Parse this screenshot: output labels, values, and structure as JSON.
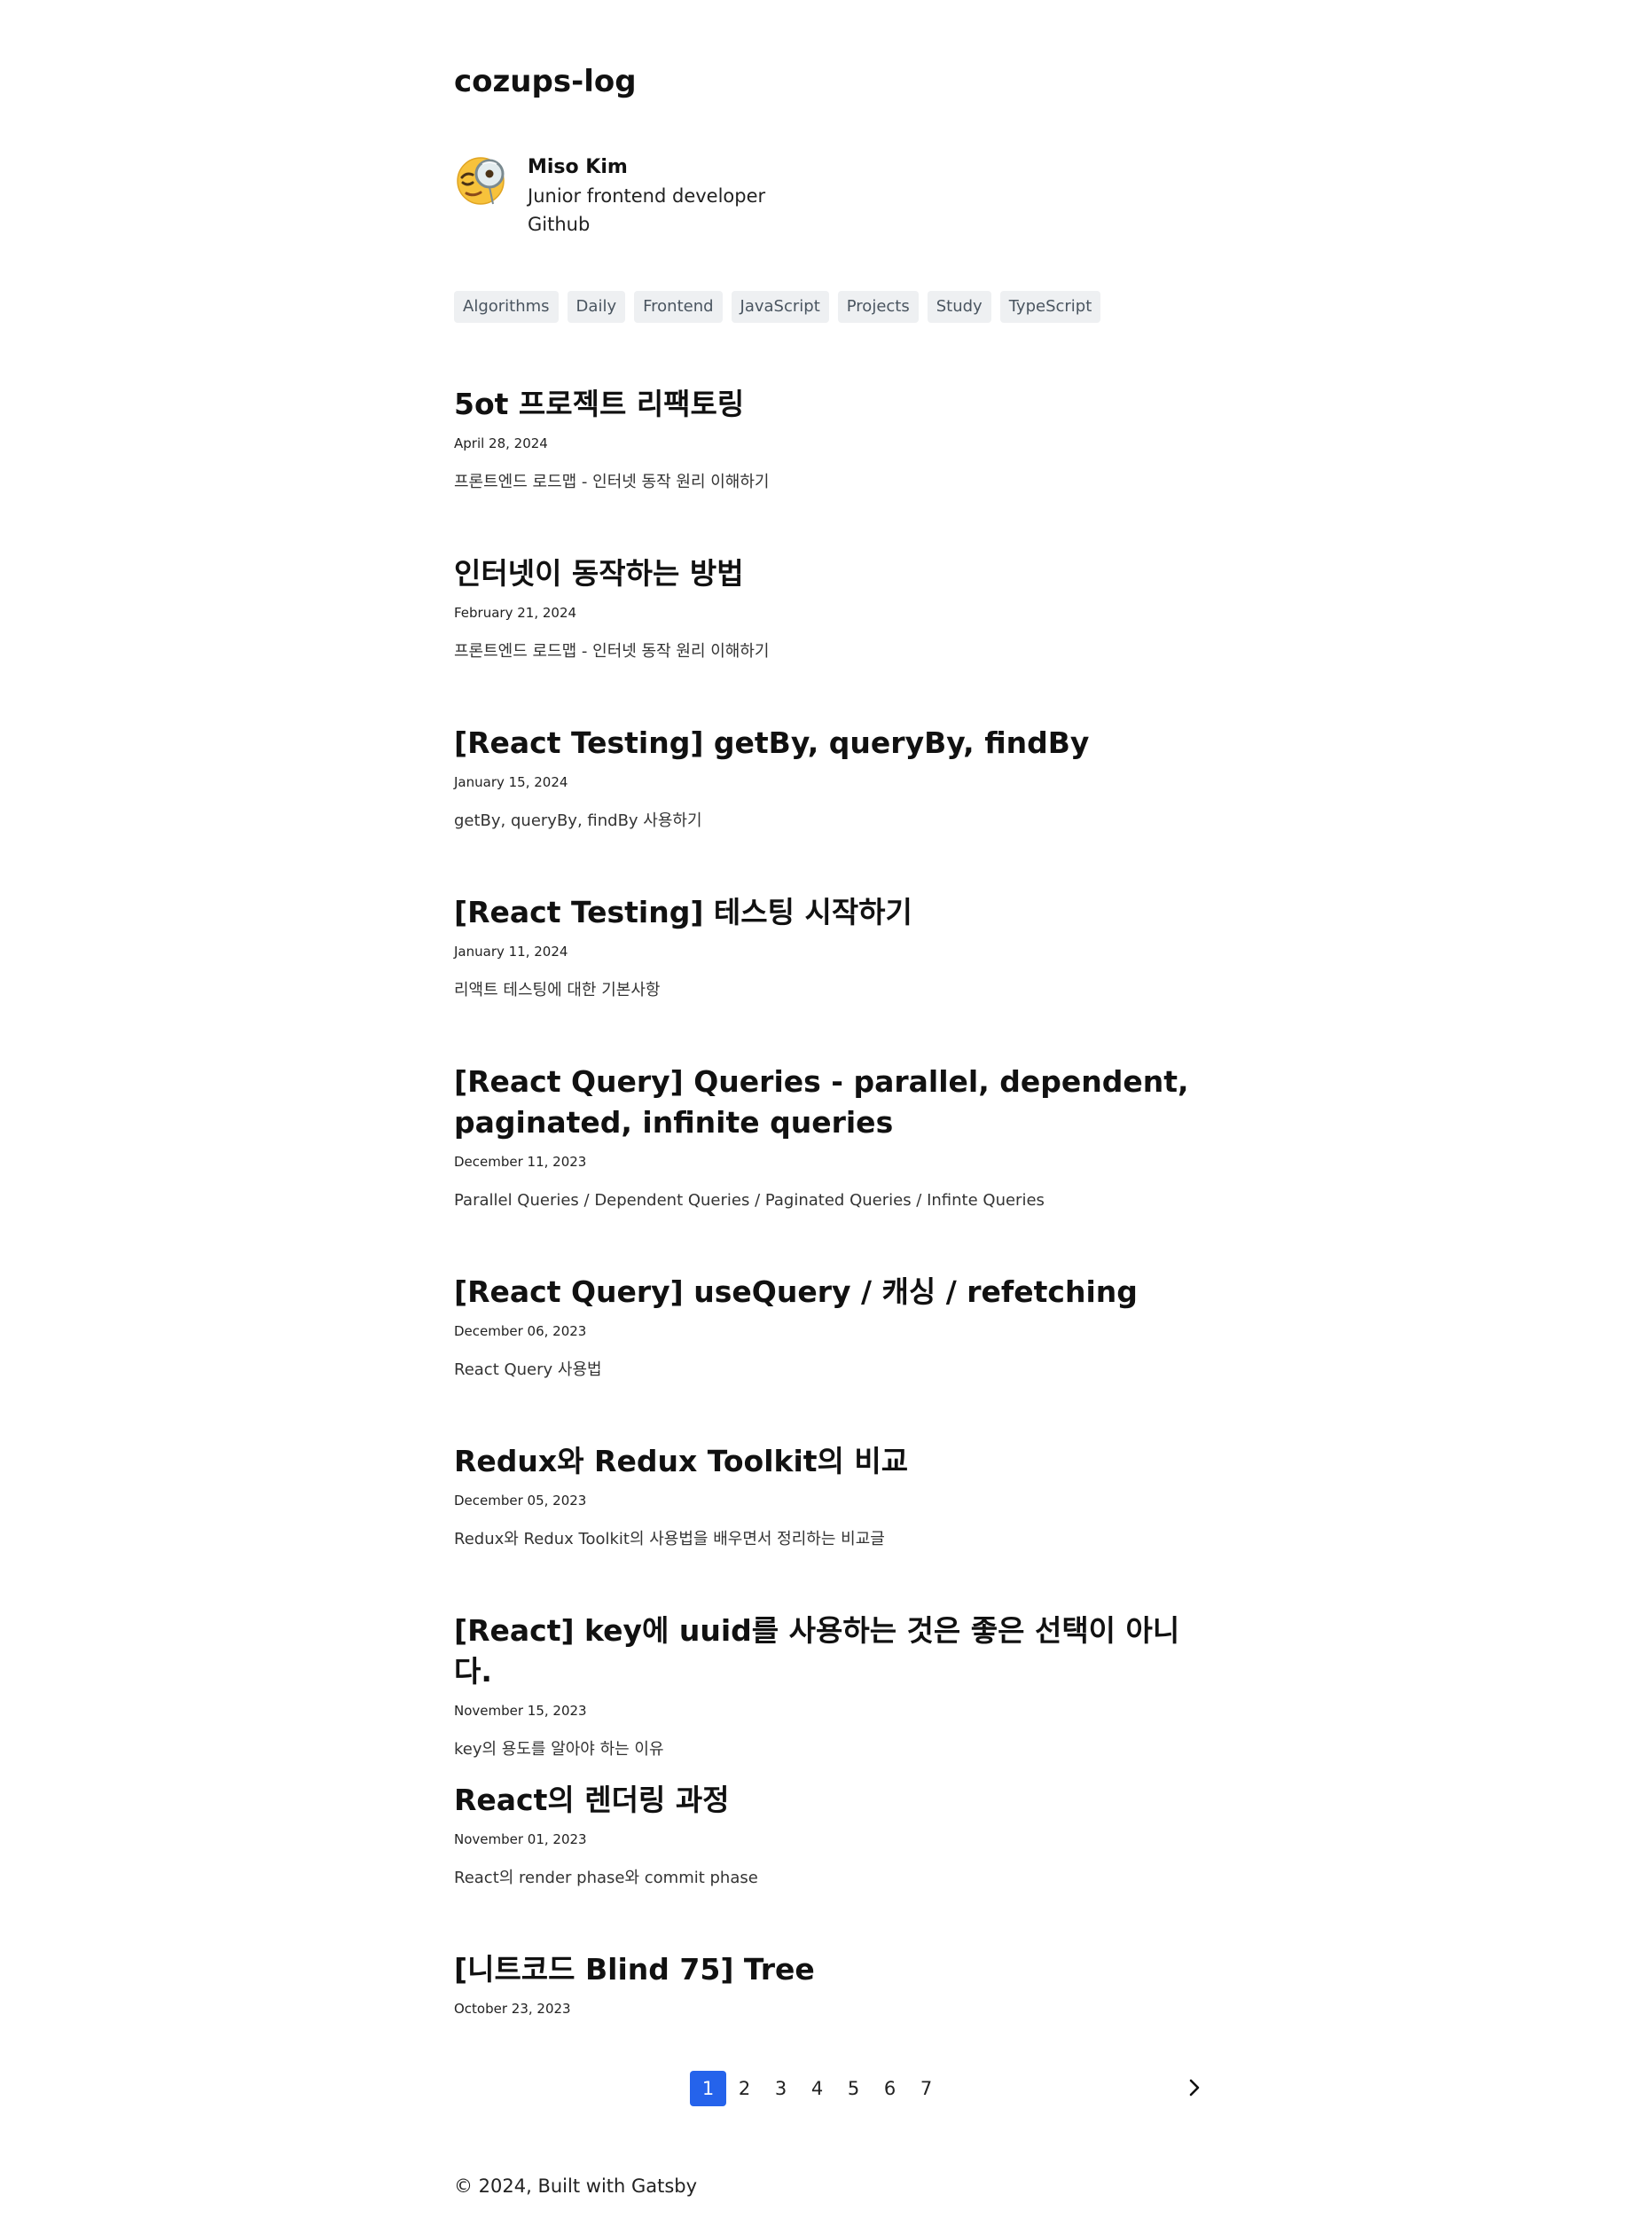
{
  "site": {
    "title": "cozups-log"
  },
  "profile": {
    "avatar_icon": "face-with-monocle-emoji",
    "name": "Miso Kim",
    "role": "Junior frontend developer",
    "link_label": "Github"
  },
  "tags": [
    {
      "label": "Algorithms"
    },
    {
      "label": "Daily"
    },
    {
      "label": "Frontend"
    },
    {
      "label": "JavaScript"
    },
    {
      "label": "Projects"
    },
    {
      "label": "Study"
    },
    {
      "label": "TypeScript"
    }
  ],
  "posts": [
    {
      "title": "5ot 프로젝트 리팩토링",
      "date": "April 28, 2024",
      "description": "프론트엔드 로드맵 - 인터넷 동작 원리 이해하기"
    },
    {
      "title": "인터넷이 동작하는 방법",
      "date": "February 21, 2024",
      "description": "프론트엔드 로드맵 - 인터넷 동작 원리 이해하기"
    },
    {
      "title": "[React Testing] getBy, queryBy, findBy",
      "date": "January 15, 2024",
      "description": "getBy, queryBy, findBy 사용하기"
    },
    {
      "title": "[React Testing] 테스팅 시작하기",
      "date": "January 11, 2024",
      "description": "리액트 테스팅에 대한 기본사항"
    },
    {
      "title": "[React Query] Queries - parallel, dependent, paginated, infinite queries",
      "date": "December 11, 2023",
      "description": "Parallel Queries / Dependent Queries / Paginated Queries / Infinte Queries"
    },
    {
      "title": "[React Query] useQuery / 캐싱 / refetching",
      "date": "December 06, 2023",
      "description": "React Query 사용법"
    },
    {
      "title": "Redux와 Redux Toolkit의 비교",
      "date": "December 05, 2023",
      "description": "Redux와 Redux Toolkit의 사용법을 배우면서 정리하는 비교글"
    },
    {
      "title": "[React] key에 uuid를 사용하는 것은 좋은 선택이 아니다.",
      "date": "November 15, 2023",
      "description": "key의 용도를 알아야 하는 이유"
    },
    {
      "title": "React의 렌더링 과정",
      "date": "November 01, 2023",
      "description": "React의 render phase와 commit phase"
    },
    {
      "title": "[니트코드 Blind 75] Tree",
      "date": "October 23, 2023",
      "description": ""
    }
  ],
  "pagination": {
    "current": "1",
    "pages": [
      "1",
      "2",
      "3",
      "4",
      "5",
      "6",
      "7"
    ],
    "next_icon": "chevron-right-icon"
  },
  "footer": {
    "text": "© 2024, Built with Gatsby"
  },
  "colors": {
    "accent": "#2563eb",
    "tag_bg": "#eef0f2",
    "tag_text": "#4a5560",
    "text": "#111111"
  }
}
